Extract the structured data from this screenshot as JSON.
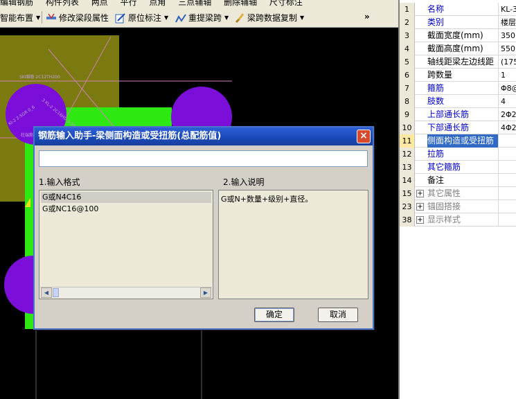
{
  "toolbar_top": {
    "items": [
      "编辑钢筋",
      "构件列表",
      "两点",
      "平行",
      "点角",
      "三点辅轴",
      "删除辅轴",
      "尺寸标注"
    ]
  },
  "toolbar": {
    "smart_layout": "智能布置",
    "modify_span_props": "修改梁段属性",
    "original_annotation": "原位标注",
    "reextract_span": "重提梁跨",
    "copy_span_data": "梁跨数据复制",
    "overflow": "»"
  },
  "canvas": {
    "labels": [
      "SKI雜筋 2C12TH200",
      "3 KL-2 2C16HD 5-35/3t",
      "BKI20 7t",
      "KI-2 2-5GR 0_6",
      "柱端筋"
    ]
  },
  "properties": {
    "rows": [
      {
        "num": "1",
        "name": "名称",
        "value": "KL-3",
        "blue": true
      },
      {
        "num": "2",
        "name": "类别",
        "value": "楼层",
        "blue": true
      },
      {
        "num": "3",
        "name": "截面宽度(mm)",
        "value": "350",
        "blue": false
      },
      {
        "num": "4",
        "name": "截面高度(mm)",
        "value": "550",
        "blue": false
      },
      {
        "num": "5",
        "name": "轴线距梁左边线距",
        "value": "(175",
        "blue": false
      },
      {
        "num": "6",
        "name": "跨数量",
        "value": "1",
        "blue": false
      },
      {
        "num": "7",
        "name": "箍筋",
        "value": "Φ8@",
        "blue": true
      },
      {
        "num": "8",
        "name": "肢数",
        "value": "4",
        "blue": true
      },
      {
        "num": "9",
        "name": "上部通长筋",
        "value": "2Φ2",
        "blue": true
      },
      {
        "num": "10",
        "name": "下部通长筋",
        "value": "4Φ2",
        "blue": true
      },
      {
        "num": "11",
        "name": "侧面构造或受扭筋",
        "value": "",
        "blue": false,
        "selected": true
      },
      {
        "num": "12",
        "name": "拉筋",
        "value": "",
        "blue": true
      },
      {
        "num": "13",
        "name": "其它箍筋",
        "value": "",
        "blue": true
      },
      {
        "num": "14",
        "name": "备注",
        "value": "",
        "blue": false
      },
      {
        "num": "15",
        "name": "其它属性",
        "value": "",
        "group": true
      },
      {
        "num": "23",
        "name": "锚固搭接",
        "value": "",
        "group": true
      },
      {
        "num": "38",
        "name": "显示样式",
        "value": "",
        "group": true
      }
    ]
  },
  "dialog": {
    "title": "钢筋输入助手-梁侧面构造或受扭筋(总配筋值)",
    "close": "×",
    "input_value": "",
    "format_label": "1.输入格式",
    "explain_label": "2.输入说明",
    "formats": [
      "G或N4C16",
      "G或NC16@100"
    ],
    "explanation": "G或N+数量+级别+直径。",
    "ok": "确定",
    "cancel": "取消"
  },
  "colors": {
    "olive": "#7a7a10",
    "purple": "#7b0fd9",
    "green": "#2ee812",
    "selection": "#316ac5"
  }
}
